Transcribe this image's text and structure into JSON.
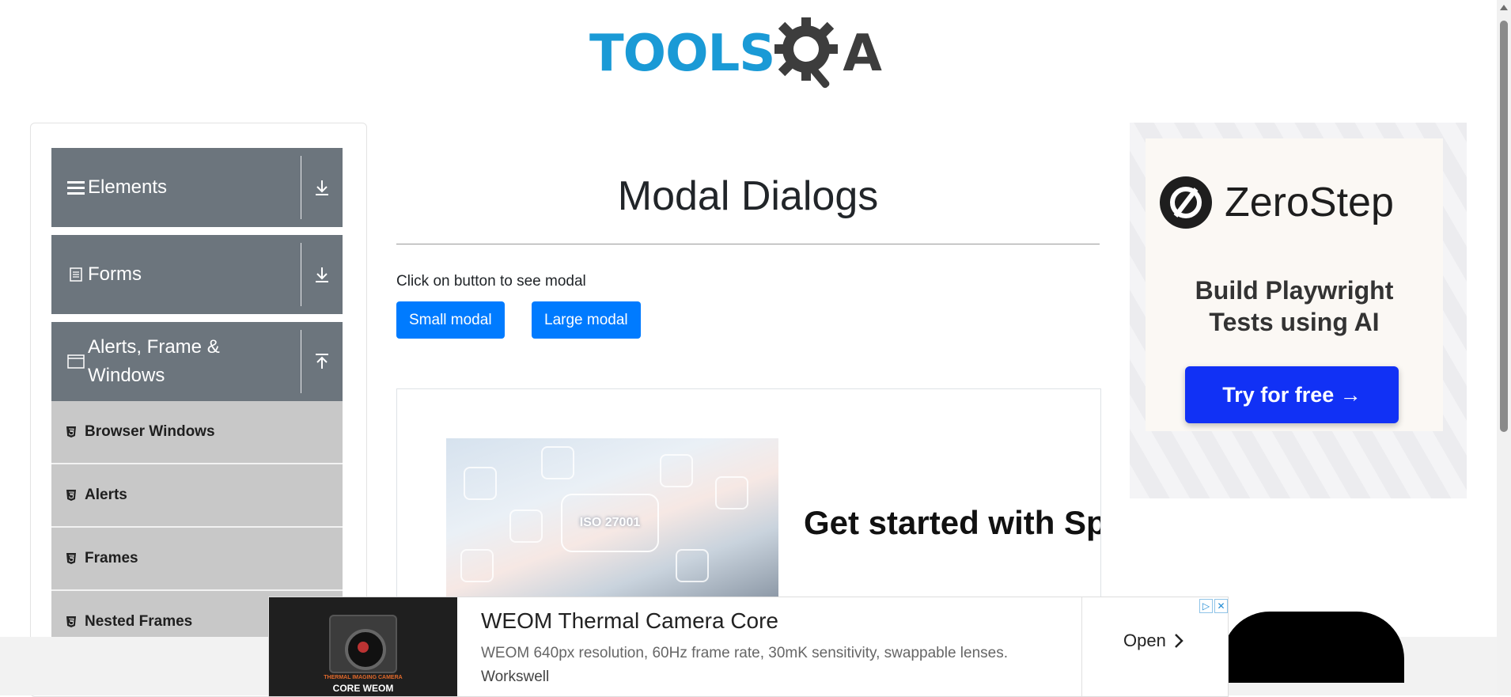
{
  "header": {
    "logo_part1": "TOOLS",
    "logo_part2": "A"
  },
  "sidebar": {
    "groups": [
      {
        "label": "Elements",
        "icon": "hamburger-icon",
        "arrow": "download-arrow-icon"
      },
      {
        "label": "Forms",
        "icon": "document-icon",
        "arrow": "download-arrow-icon"
      },
      {
        "label": "Alerts, Frame & Windows",
        "icon": "window-icon",
        "arrow": "upload-arrow-icon"
      }
    ],
    "items": [
      {
        "label": "Browser Windows",
        "icon": "html5-icon"
      },
      {
        "label": "Alerts",
        "icon": "html5-icon"
      },
      {
        "label": "Frames",
        "icon": "html5-icon"
      },
      {
        "label": "Nested Frames",
        "icon": "html5-icon"
      }
    ]
  },
  "main": {
    "title": "Modal Dialogs",
    "hint": "Click on button to see modal",
    "small_button": "Small modal",
    "large_button": "Large modal",
    "ad": {
      "heading": "Get started with Sprinto",
      "image_text": "ISO 27001"
    }
  },
  "right_ad": {
    "brand": "ZeroStep",
    "tagline_line1": "Build Playwright",
    "tagline_line2": "Tests using AI",
    "cta": "Try for free →"
  },
  "bottom_ad": {
    "title": "WEOM Thermal Camera Core",
    "description": "WEOM 640px resolution, 60Hz frame rate, 30mK sensitivity, swappable lenses.",
    "brand": "Workswell",
    "open_label": "Open",
    "image_caption_small": "THERMAL IMAGING CAMERA",
    "image_caption": "CORE WEOM"
  },
  "colors": {
    "accent_blue": "#007bff",
    "sidebar_header": "#6c757d",
    "sidebar_item": "#c8c8c8",
    "logo_blue": "#1a9ad6",
    "zerostep_button": "#1131f5"
  }
}
